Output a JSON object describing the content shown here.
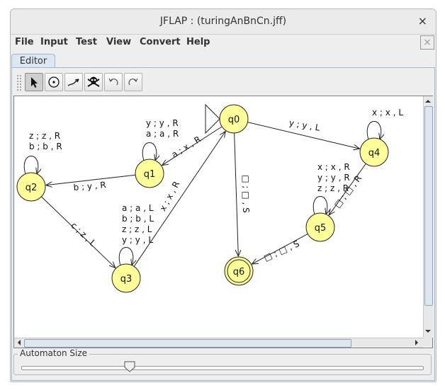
{
  "window": {
    "title": "JFLAP : (turingAnBnCn.jff)",
    "close_glyph": "×"
  },
  "menu": [
    "File",
    "Input",
    "Test",
    "View",
    "Convert",
    "Help"
  ],
  "menu_close_glyph": "×",
  "tabs": [
    {
      "label": "Editor",
      "selected": true
    }
  ],
  "toolbar": {
    "tools": [
      {
        "name": "attribute-editor",
        "icon": "arrow-pointer-icon",
        "selected": true
      },
      {
        "name": "state-creator",
        "icon": "state-circle-icon",
        "selected": false
      },
      {
        "name": "transition-creator",
        "icon": "transition-arrow-icon",
        "selected": false
      },
      {
        "name": "deleter",
        "icon": "skull-icon",
        "selected": false
      },
      {
        "name": "undo",
        "icon": "undo-icon",
        "selected": false
      },
      {
        "name": "redo",
        "icon": "redo-icon",
        "selected": false
      }
    ]
  },
  "automaton": {
    "state_fill": "#ffff99",
    "states": [
      {
        "id": "q0",
        "label": "q0",
        "initial": true,
        "final": false
      },
      {
        "id": "q1",
        "label": "q1",
        "initial": false,
        "final": false
      },
      {
        "id": "q2",
        "label": "q2",
        "initial": false,
        "final": false
      },
      {
        "id": "q3",
        "label": "q3",
        "initial": false,
        "final": false
      },
      {
        "id": "q4",
        "label": "q4",
        "initial": false,
        "final": false
      },
      {
        "id": "q5",
        "label": "q5",
        "initial": false,
        "final": false
      },
      {
        "id": "q6",
        "label": "q6",
        "initial": false,
        "final": true
      }
    ],
    "transitions": [
      {
        "from": "q1",
        "to": "q1",
        "labels": [
          "y ; y , R",
          "a ; a , R"
        ]
      },
      {
        "from": "q2",
        "to": "q2",
        "labels": [
          "z ; z , R",
          "b ; b , R"
        ]
      },
      {
        "from": "q3",
        "to": "q3",
        "labels": [
          "a ; a , L",
          "b ; b , L",
          "z ; z , L",
          "y ; y , L"
        ]
      },
      {
        "from": "q4",
        "to": "q4",
        "labels": [
          "x ; x , L"
        ]
      },
      {
        "from": "q5",
        "to": "q5",
        "labels": [
          "x ; x , R",
          "y ; y , R",
          "z ; z , R"
        ]
      },
      {
        "from": "q0",
        "to": "q1",
        "labels": [
          "a ; x , R"
        ]
      },
      {
        "from": "q1",
        "to": "q2",
        "labels": [
          "b ; y , R"
        ]
      },
      {
        "from": "q2",
        "to": "q3",
        "labels": [
          "c ; z , L"
        ]
      },
      {
        "from": "q3",
        "to": "q0",
        "labels": [
          "x ; x , R"
        ]
      },
      {
        "from": "q0",
        "to": "q4",
        "labels": [
          "y ; y , L"
        ]
      },
      {
        "from": "q0",
        "to": "q6",
        "labels": [
          "□ ; □ , S"
        ]
      },
      {
        "from": "q4",
        "to": "q5",
        "labels": [
          "□ ; □ , R"
        ]
      },
      {
        "from": "q5",
        "to": "q6",
        "labels": [
          "□ ; □ , S"
        ]
      }
    ]
  },
  "size_panel": {
    "label": "Automaton Size",
    "slider_value": 0.27
  }
}
